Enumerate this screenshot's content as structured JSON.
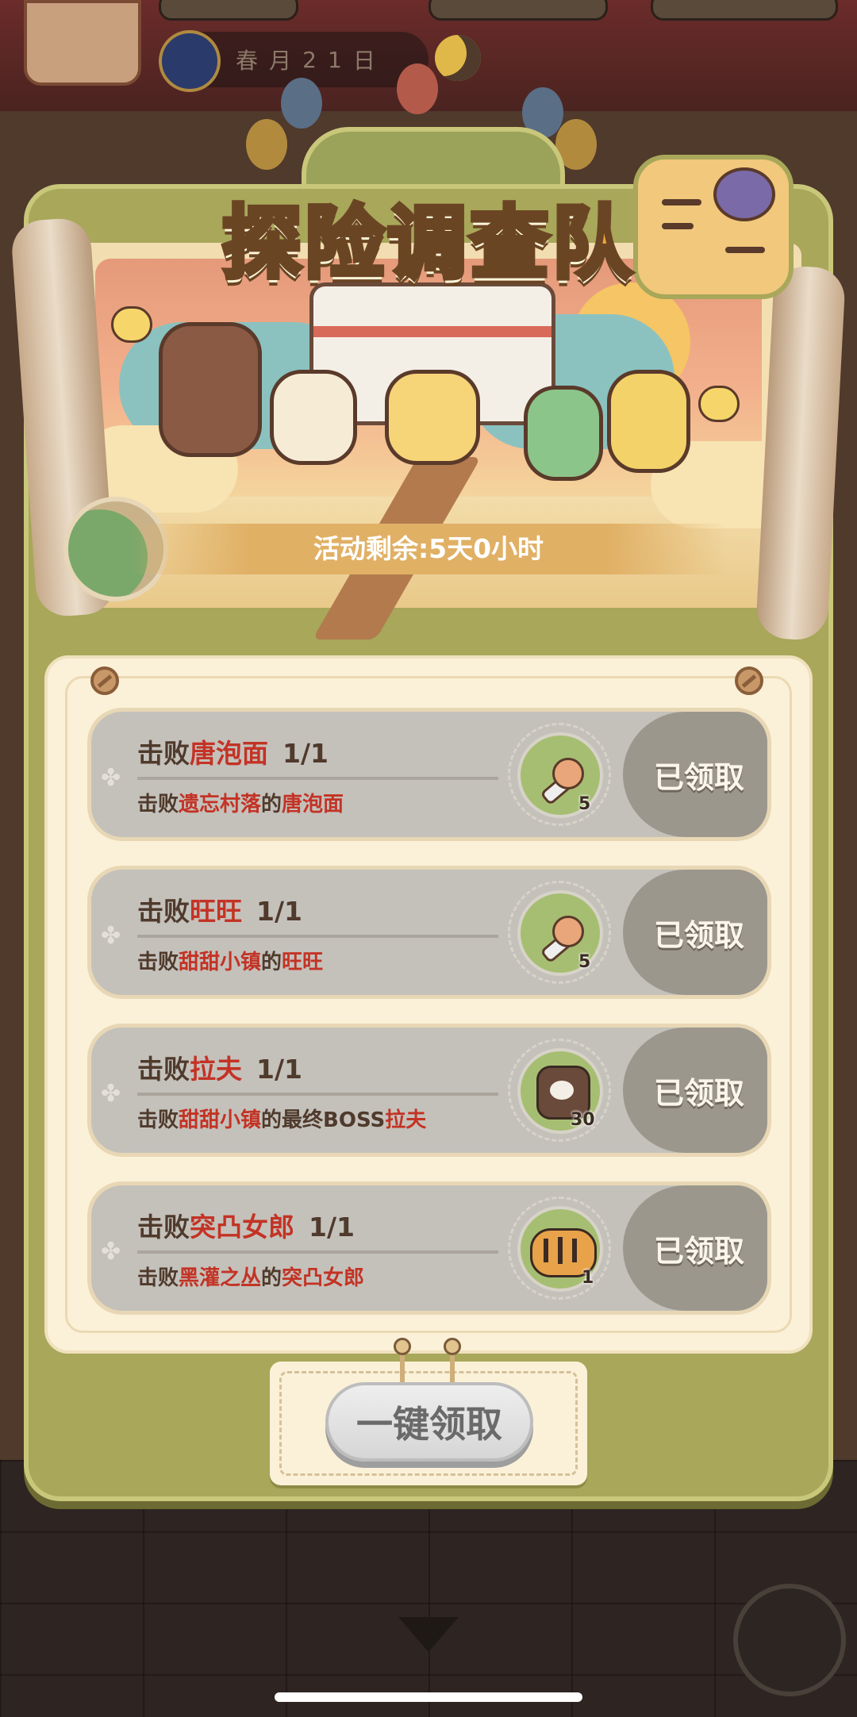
{
  "header": {
    "date_chars": [
      "春",
      "月",
      "2",
      "1",
      "日"
    ]
  },
  "event": {
    "title": "探险调查队",
    "time_remaining": "活动剩余:5天0小时"
  },
  "tasks": [
    {
      "title_prefix": "击败",
      "title_target": "唐泡面",
      "progress": "1/1",
      "desc_prefix": "击败",
      "desc_place": "遗忘村落",
      "desc_mid": "的",
      "desc_target": "唐泡面",
      "reward_icon": "paw-bone-icon",
      "reward_qty": "5",
      "claim_label": "已领取"
    },
    {
      "title_prefix": "击败",
      "title_target": "旺旺",
      "progress": "1/1",
      "desc_prefix": "击败",
      "desc_place": "甜甜小镇",
      "desc_mid": "的",
      "desc_target": "旺旺",
      "reward_icon": "paw-bone-icon",
      "reward_qty": "5",
      "claim_label": "已领取"
    },
    {
      "title_prefix": "击败",
      "title_target": "拉夫",
      "progress": "1/1",
      "desc_prefix": "击败",
      "desc_place": "甜甜小镇",
      "desc_mid": "的最终BOSS",
      "desc_target": "拉夫",
      "reward_icon": "bear-hood-icon",
      "reward_qty": "30",
      "claim_label": "已领取"
    },
    {
      "title_prefix": "击败",
      "title_target": "突凸女郎",
      "progress": "1/1",
      "desc_prefix": "击败",
      "desc_place": "黑灌之丛",
      "desc_mid": "的",
      "desc_target": "突凸女郎",
      "reward_icon": "tiger-icon",
      "reward_qty": "1",
      "claim_label": "已领取"
    }
  ],
  "claim_all_label": "一键领取",
  "colors": {
    "highlight": "#c33325",
    "panel": "#a8a75a",
    "title_orange": "#f2a73c"
  }
}
